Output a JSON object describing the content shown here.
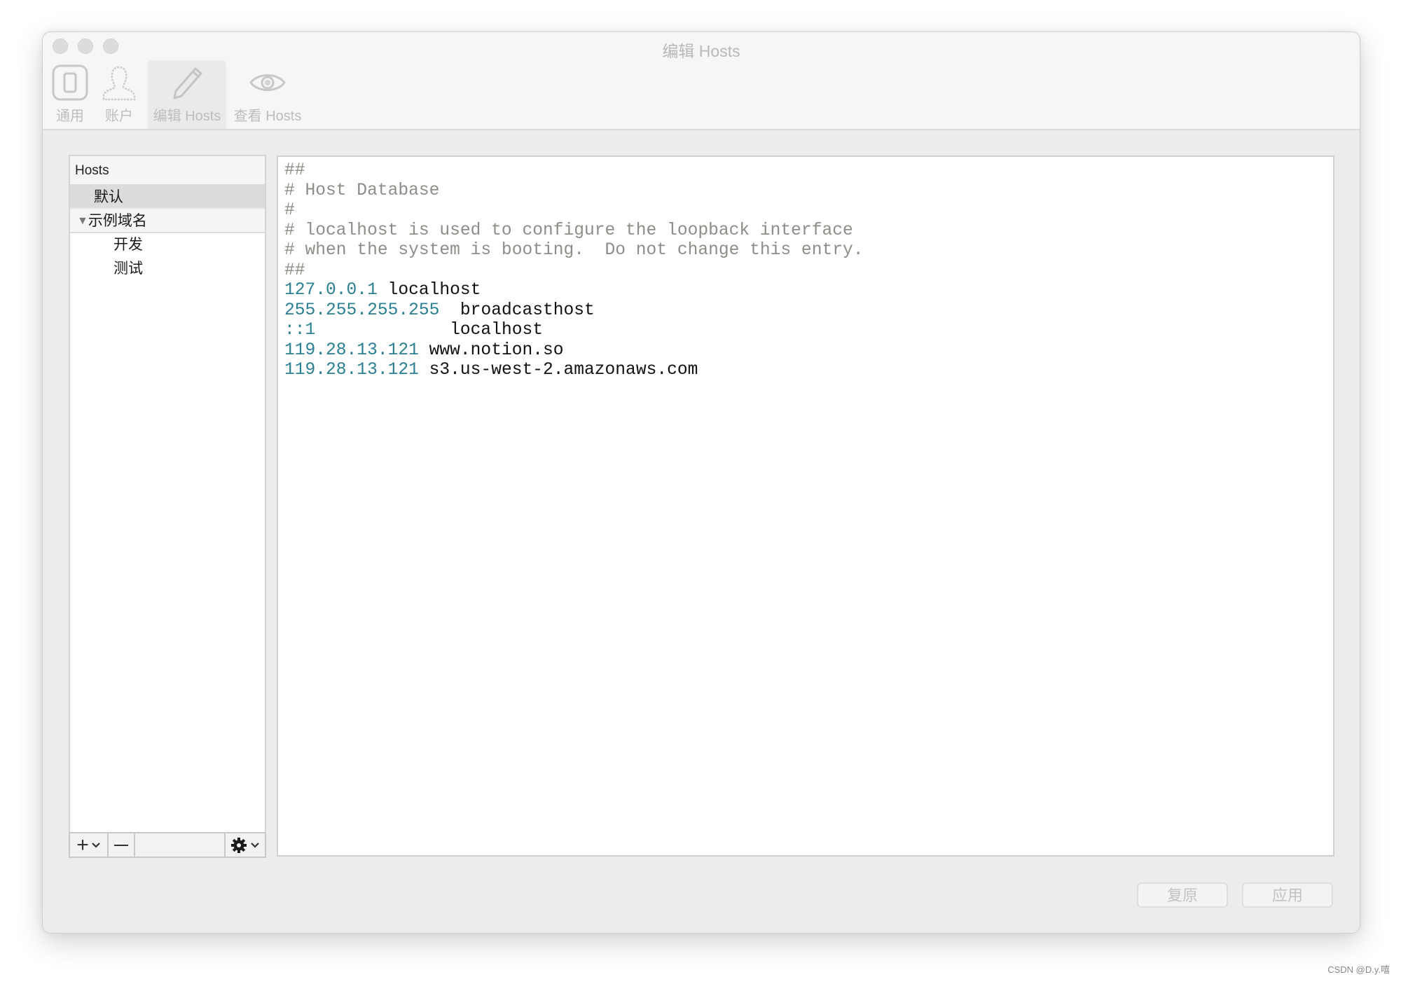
{
  "window": {
    "title": "编辑 Hosts",
    "traffic_lights": [
      "close",
      "minimize",
      "zoom"
    ]
  },
  "toolbar": {
    "items": [
      {
        "label": "通用",
        "icon": "device-icon",
        "selected": false
      },
      {
        "label": "账户",
        "icon": "user-icon",
        "selected": false
      },
      {
        "label": "编辑 Hosts",
        "icon": "pencil-icon",
        "selected": true
      },
      {
        "label": "查看 Hosts",
        "icon": "eye-icon",
        "selected": false
      }
    ]
  },
  "sidebar": {
    "header": "Hosts",
    "items": [
      {
        "label": "默认",
        "level": 0,
        "selected": true
      },
      {
        "label": "示例域名",
        "level": 0,
        "group": true,
        "expanded": true,
        "disclosure": "▼"
      },
      {
        "label": "开发",
        "level": 1
      },
      {
        "label": "测试",
        "level": 1
      }
    ],
    "bottom_bar": {
      "add_label": "+",
      "add_menu": "⌄",
      "remove_label": "—",
      "gear_label": "⚙",
      "gear_menu": "⌄"
    }
  },
  "editor": {
    "lines": [
      {
        "type": "comment",
        "text": "##"
      },
      {
        "type": "comment",
        "text": "# Host Database"
      },
      {
        "type": "comment",
        "text": "#"
      },
      {
        "type": "comment",
        "text": "# localhost is used to configure the loopback interface"
      },
      {
        "type": "comment",
        "text": "# when the system is booting.  Do not change this entry."
      },
      {
        "type": "comment",
        "text": "##"
      },
      {
        "type": "entry",
        "ip": "127.0.0.1",
        "sep": " ",
        "host": "localhost"
      },
      {
        "type": "entry",
        "ip": "255.255.255.255",
        "sep": "  ",
        "host": "broadcasthost"
      },
      {
        "type": "entry",
        "ip": "::1",
        "sep": "             ",
        "host": "localhost"
      },
      {
        "type": "entry",
        "ip": "119.28.13.121",
        "sep": " ",
        "host": "www.notion.so"
      },
      {
        "type": "entry",
        "ip": "119.28.13.121",
        "sep": " ",
        "host": "s3.us-west-2.amazonaws.com"
      }
    ]
  },
  "footer": {
    "revert_label": "复原",
    "apply_label": "应用"
  },
  "watermark": "CSDN @D.y.嘻",
  "colors": {
    "comment": "#8a8f87",
    "ip": "#2b7f93",
    "host": "#111111"
  }
}
